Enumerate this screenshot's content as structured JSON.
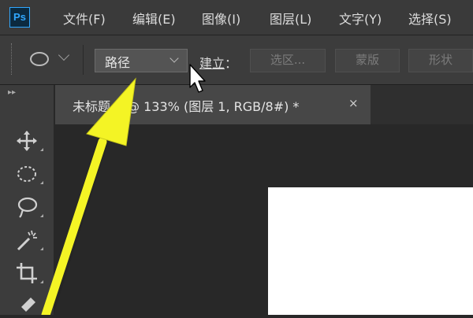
{
  "app": {
    "logo_text": "Ps"
  },
  "menu": {
    "items": [
      {
        "label": "文件(F)"
      },
      {
        "label": "编辑(E)"
      },
      {
        "label": "图像(I)"
      },
      {
        "label": "图层(L)"
      },
      {
        "label": "文字(Y)"
      },
      {
        "label": "选择(S)"
      }
    ]
  },
  "options": {
    "mode_value": "路径",
    "make_label_main": "建立",
    "make_label_colon": "：",
    "selection_button": "选区...",
    "mask_button": "蒙版",
    "shape_button": "形状"
  },
  "document": {
    "tab_title": "未标题-1 @ 133% (图层 1, RGB/8#) *",
    "close_glyph": "×"
  },
  "toolbar": {
    "collapse_glyph": "▸▸",
    "tools": [
      "move",
      "elliptical-marquee",
      "lasso",
      "magic-wand",
      "crop",
      "eyedropper"
    ]
  },
  "colors": {
    "accent": "#31a8ff",
    "annotation_arrow": "#f4f425"
  }
}
